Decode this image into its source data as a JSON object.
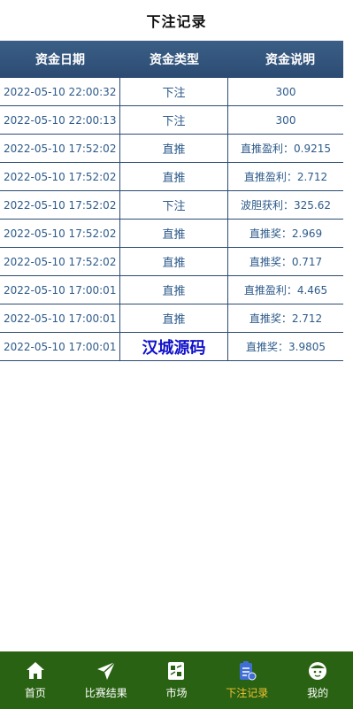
{
  "header": {
    "title": "下注记录"
  },
  "table": {
    "columns": [
      "资金日期",
      "资金类型",
      "资金说明"
    ],
    "rows": [
      {
        "date": "2022-05-10 22:00:32",
        "type": "下注",
        "desc": "300"
      },
      {
        "date": "2022-05-10 22:00:13",
        "type": "下注",
        "desc": "300"
      },
      {
        "date": "2022-05-10 17:52:02",
        "type": "直推",
        "desc": "直推盈利：0.9215"
      },
      {
        "date": "2022-05-10 17:52:02",
        "type": "直推",
        "desc": "直推盈利：2.712"
      },
      {
        "date": "2022-05-10 17:52:02",
        "type": "下注",
        "desc": "波胆获利：325.62"
      },
      {
        "date": "2022-05-10 17:52:02",
        "type": "直推",
        "desc": "直推奖：2.969"
      },
      {
        "date": "2022-05-10 17:52:02",
        "type": "直推",
        "desc": "直推奖：0.717"
      },
      {
        "date": "2022-05-10 17:00:01",
        "type": "直推",
        "desc": "直推盈利：4.465"
      },
      {
        "date": "2022-05-10 17:00:01",
        "type": "直推",
        "desc": "直推奖：2.712"
      },
      {
        "date": "2022-05-10 17:00:01",
        "type": "汉城源码",
        "desc": "直推奖：3.9805"
      }
    ]
  },
  "tabbar": {
    "items": [
      {
        "label": "首页",
        "icon": "home-icon"
      },
      {
        "label": "比赛结果",
        "icon": "paper-plane-icon"
      },
      {
        "label": "市场",
        "icon": "market-icon"
      },
      {
        "label": "下注记录",
        "icon": "clipboard-icon",
        "active": true
      },
      {
        "label": "我的",
        "icon": "face-icon"
      }
    ]
  },
  "colors": {
    "header_bg": "#2c4b73",
    "row_text": "#2d5a8a",
    "tabbar_bg": "#2a6213",
    "tab_active": "#f2c230",
    "watermark": "#1111cc"
  }
}
